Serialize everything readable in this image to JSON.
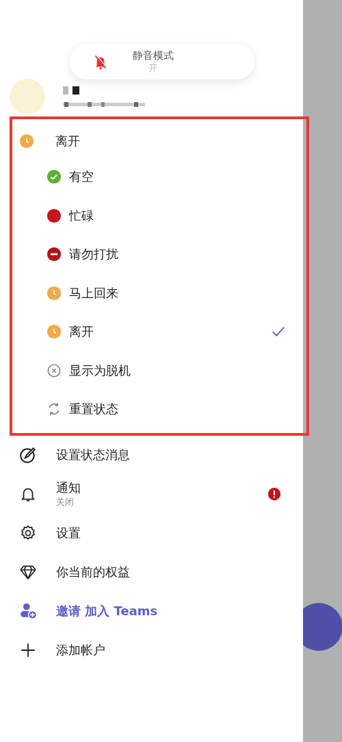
{
  "toast": {
    "title": "静音模式",
    "value": "开",
    "kind": "muted"
  },
  "current_status": {
    "label": "离开",
    "kind": "away"
  },
  "statuses": [
    {
      "label": "有空",
      "kind": "available",
      "selected": false
    },
    {
      "label": "忙碌",
      "kind": "busy",
      "selected": false
    },
    {
      "label": "请勿打扰",
      "kind": "dnd",
      "selected": false
    },
    {
      "label": "马上回来",
      "kind": "brb",
      "selected": false
    },
    {
      "label": "离开",
      "kind": "away",
      "selected": true
    },
    {
      "label": "显示为脱机",
      "kind": "offline",
      "selected": false
    },
    {
      "label": "重置状态",
      "kind": "reset",
      "selected": false
    }
  ],
  "menu": [
    {
      "label": "设置状态消息",
      "kind": "status-message"
    },
    {
      "label": "通知",
      "sublabel": "关闭",
      "kind": "notifications",
      "alert": true
    },
    {
      "label": "设置",
      "kind": "settings"
    },
    {
      "label": "你当前的权益",
      "kind": "benefits"
    },
    {
      "label": "邀请 加入 Teams",
      "kind": "invite"
    },
    {
      "label": "添加帐户",
      "kind": "add-account"
    }
  ]
}
